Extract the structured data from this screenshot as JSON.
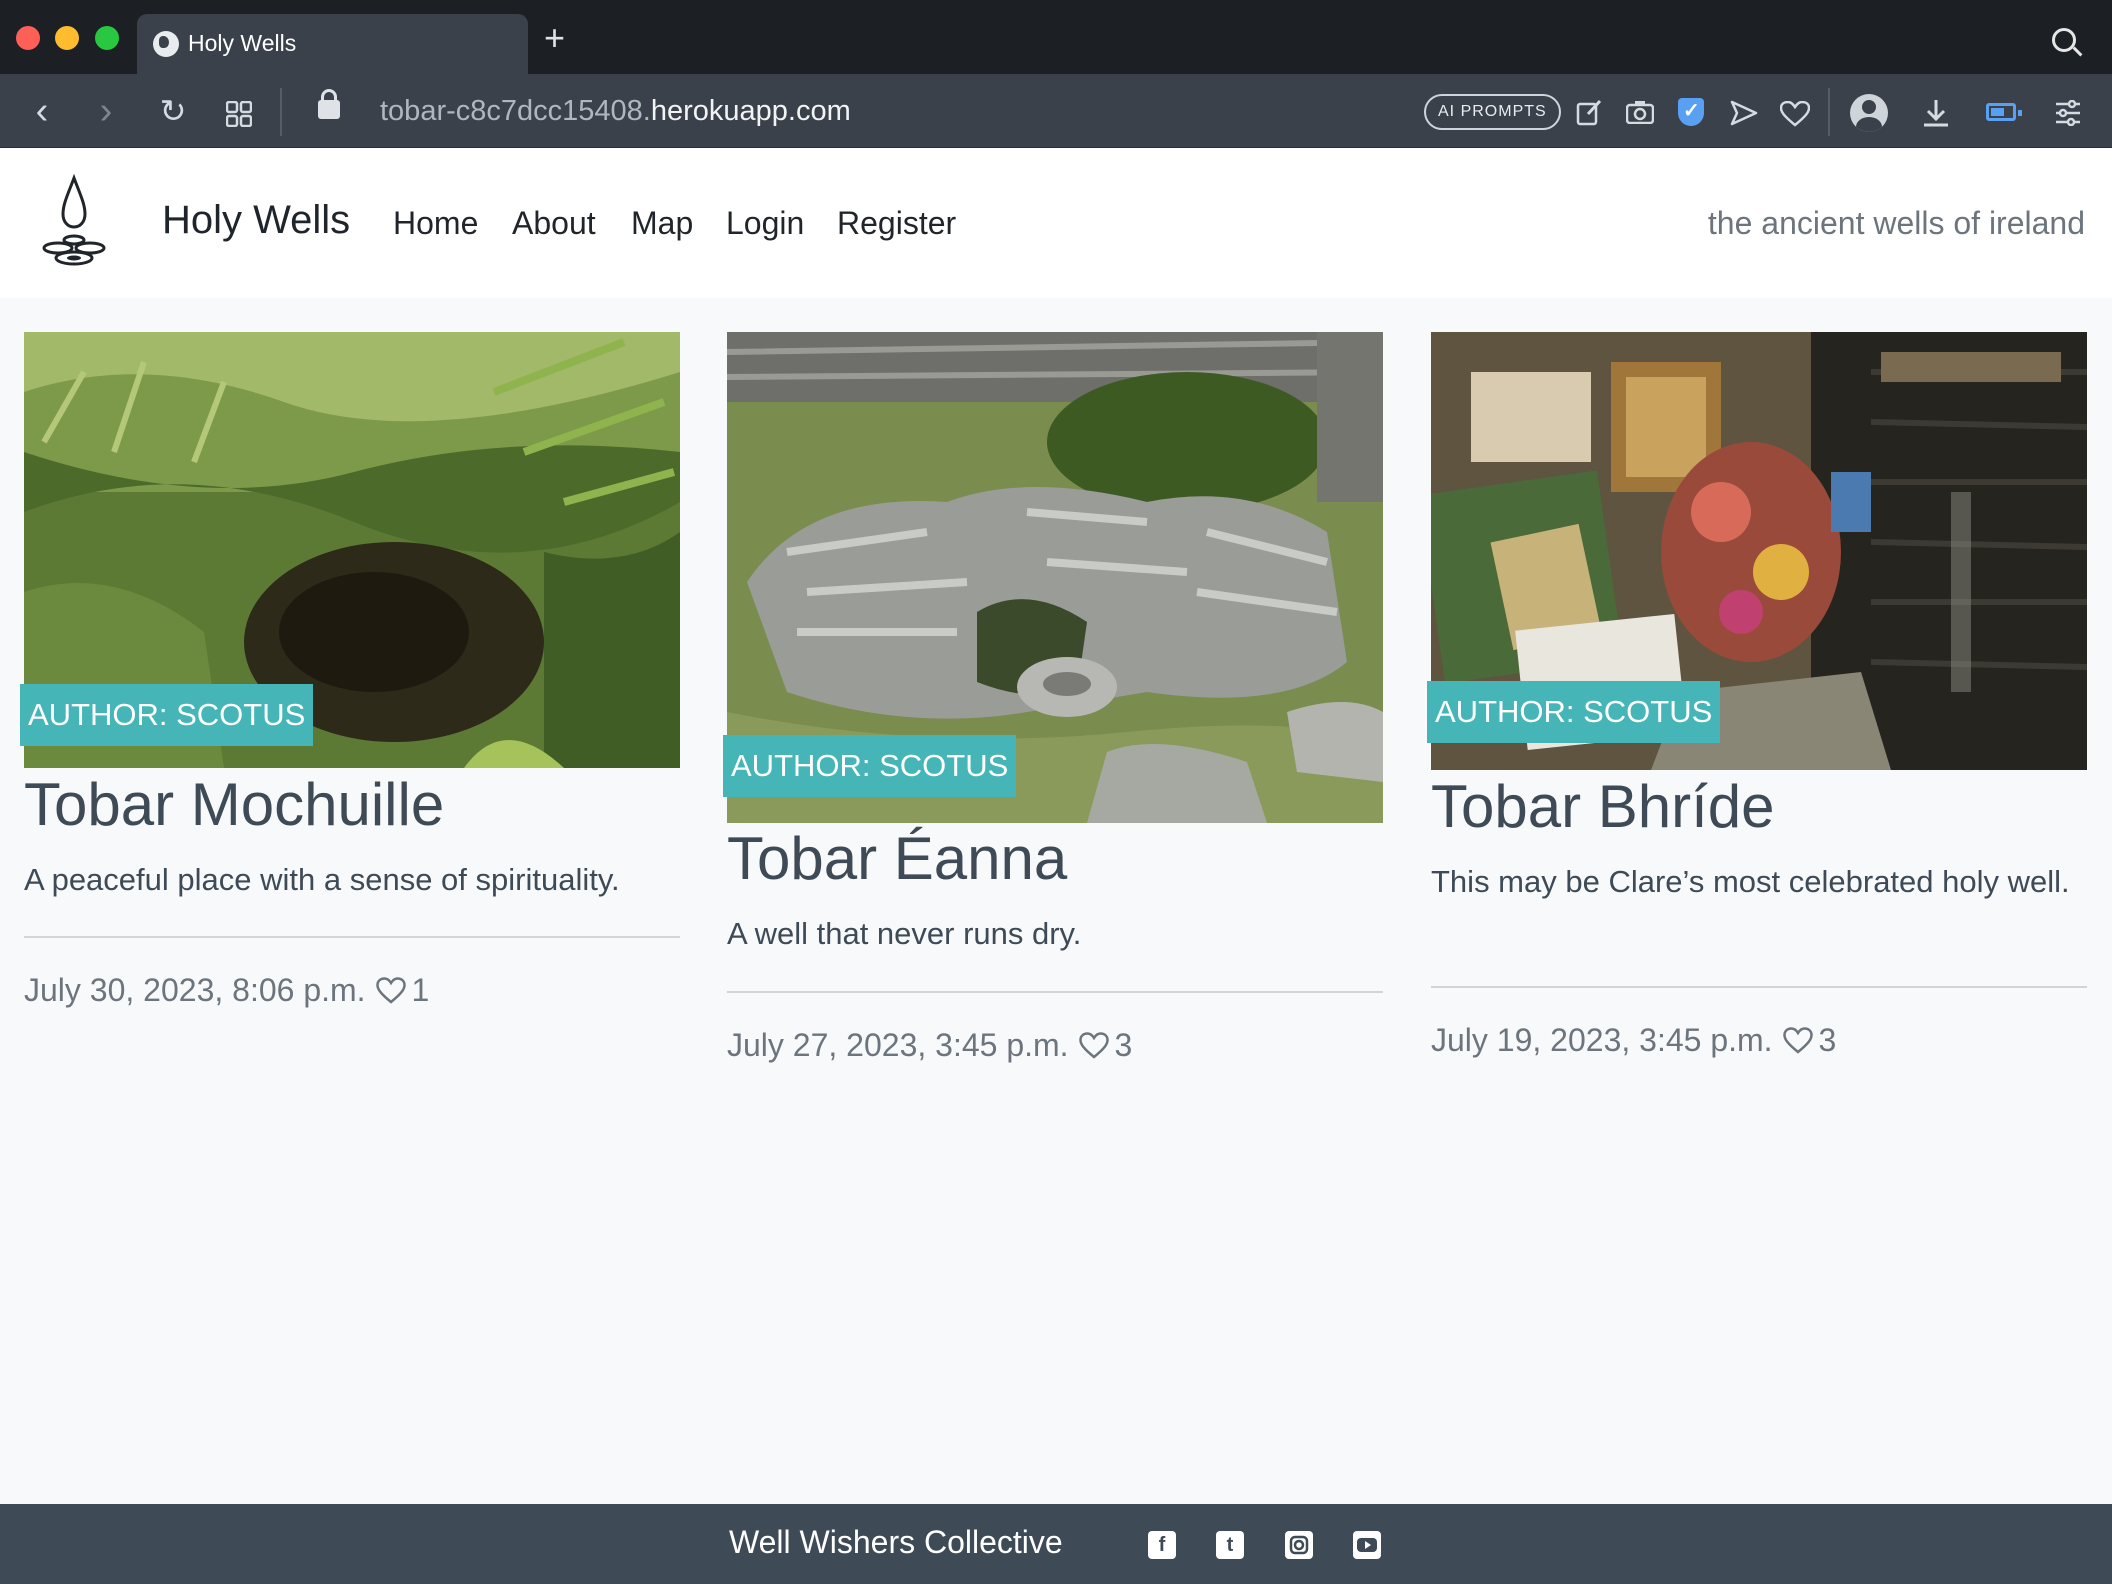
{
  "browser": {
    "tab_title": "Holy Wells",
    "url_prefix": "tobar-c8c7dcc15408.",
    "url_host": "herokuapp.com",
    "ai_prompts_label": "AI PROMPTS"
  },
  "navbar": {
    "brand": "Holy Wells",
    "links": [
      "Home",
      "About",
      "Map",
      "Login",
      "Register"
    ],
    "tagline": "the ancient wells of ireland"
  },
  "posts": [
    {
      "author_badge": "AUTHOR: SCOTUS",
      "title": "Tobar Mochuille",
      "excerpt": "A peaceful place with a sense of spirituality.",
      "date": "July 30, 2023, 8:06 p.m.",
      "likes": "1"
    },
    {
      "author_badge": "AUTHOR: SCOTUS",
      "title": "Tobar Éanna",
      "excerpt": "A well that never runs dry.",
      "date": "July 27, 2023, 3:45 p.m.",
      "likes": "3"
    },
    {
      "author_badge": "AUTHOR: SCOTUS",
      "title": "Tobar Bhríde",
      "excerpt": "This may be Clare’s most celebrated holy well.",
      "date": "July 19, 2023, 3:45 p.m.",
      "likes": "3"
    }
  ],
  "footer": {
    "text": "Well Wishers Collective",
    "social_icons": [
      "facebook-icon",
      "twitter-icon",
      "instagram-icon",
      "youtube-icon"
    ]
  },
  "colors": {
    "badge": "#45b5b8",
    "heading": "#3e4a56",
    "footer_bg": "#3e4a56",
    "page_bg": "#f8f9fa"
  }
}
